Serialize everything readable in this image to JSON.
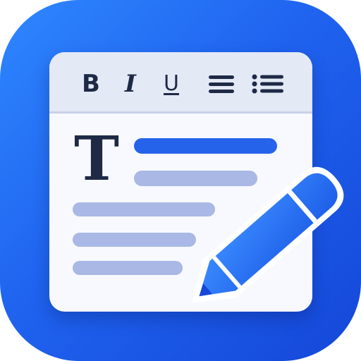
{
  "toolbar": {
    "bold_label": "B",
    "italic_label": "I",
    "underline_label": "U",
    "align_icon": "align-justify-icon",
    "list_icon": "bulleted-list-icon"
  },
  "editor": {
    "heading_glyph": "T",
    "line_icons": [
      "text-line-highlight",
      "text-line",
      "text-line",
      "text-line",
      "text-line"
    ]
  },
  "colors": {
    "accent": "#2563eb",
    "background_gradient_start": "#2f87ff",
    "background_gradient_end": "#1547d8",
    "text_dark": "#1e2a45",
    "line_light": "#a9b8e4",
    "paper": "#f7f9ff"
  },
  "decorations": {
    "pencil_icon": "pencil-icon"
  }
}
